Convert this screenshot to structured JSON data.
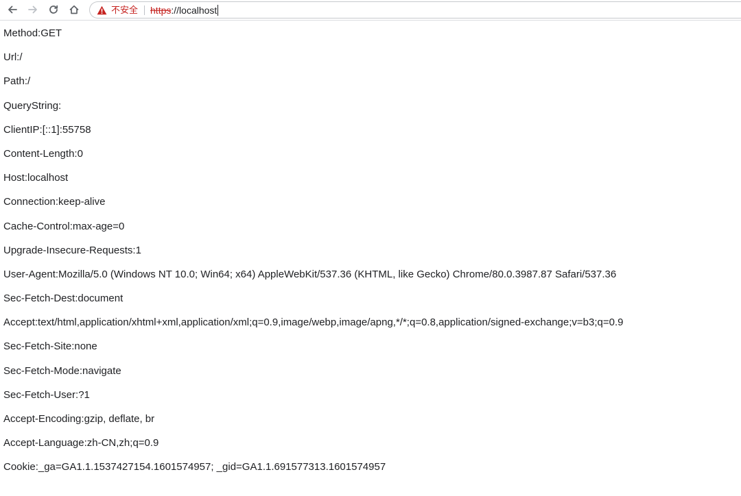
{
  "browser": {
    "security_label": "不安全",
    "url_scheme": "https",
    "url_rest": "://localhost",
    "icons": {
      "back": "back-arrow-icon",
      "forward": "forward-arrow-icon",
      "reload": "reload-icon",
      "home": "home-icon",
      "security": "warning-triangle-icon"
    },
    "colors": {
      "insecure": "#c5221f",
      "text": "#202124"
    }
  },
  "request_lines": [
    "Method:GET",
    "Url:/",
    "Path:/",
    "QueryString:",
    "ClientIP:[::1]:55758",
    "Content-Length:0",
    "Host:localhost",
    "Connection:keep-alive",
    "Cache-Control:max-age=0",
    "Upgrade-Insecure-Requests:1",
    "User-Agent:Mozilla/5.0 (Windows NT 10.0; Win64; x64) AppleWebKit/537.36 (KHTML, like Gecko) Chrome/80.0.3987.87 Safari/537.36",
    "Sec-Fetch-Dest:document",
    "Accept:text/html,application/xhtml+xml,application/xml;q=0.9,image/webp,image/apng,*/*;q=0.8,application/signed-exchange;v=b3;q=0.9",
    "Sec-Fetch-Site:none",
    "Sec-Fetch-Mode:navigate",
    "Sec-Fetch-User:?1",
    "Accept-Encoding:gzip, deflate, br",
    "Accept-Language:zh-CN,zh;q=0.9",
    "Cookie:_ga=GA1.1.1537427154.1601574957; _gid=GA1.1.691577313.1601574957"
  ]
}
